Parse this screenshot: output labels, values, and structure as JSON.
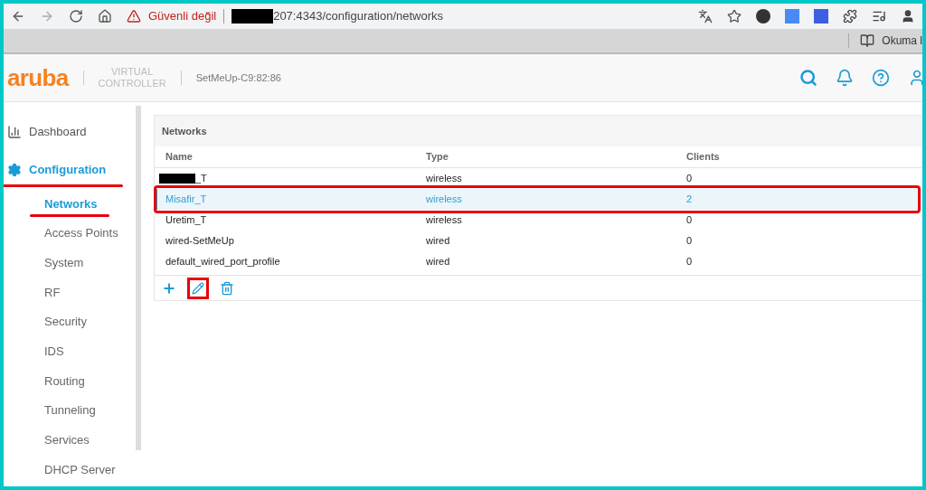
{
  "browser": {
    "security_label": "Güvenli değil",
    "url": "207:4343/configuration/networks",
    "bookmark": "Okuma l"
  },
  "header": {
    "logo": "aruba",
    "product_line1": "VIRTUAL",
    "product_line2": "CONTROLLER",
    "device": "SetMeUp-C9:82:86"
  },
  "sidebar": {
    "items": [
      {
        "label": "Dashboard",
        "kind": "dashboard",
        "selected": false
      },
      {
        "label": "Configuration",
        "kind": "settings",
        "selected": true,
        "children": [
          {
            "label": "Networks",
            "selected": true
          },
          {
            "label": "Access Points",
            "selected": false
          },
          {
            "label": "System",
            "selected": false
          },
          {
            "label": "RF",
            "selected": false
          },
          {
            "label": "Security",
            "selected": false
          },
          {
            "label": "IDS",
            "selected": false
          },
          {
            "label": "Routing",
            "selected": false
          },
          {
            "label": "Tunneling",
            "selected": false
          },
          {
            "label": "Services",
            "selected": false
          },
          {
            "label": "DHCP Server",
            "selected": false
          }
        ]
      }
    ]
  },
  "panel": {
    "title": "Networks",
    "columns": [
      "Name",
      "Type",
      "Clients"
    ],
    "rows": [
      {
        "name": "_T",
        "redacted": true,
        "type": "wireless",
        "clients": "0",
        "selected": false
      },
      {
        "name": "Misafir_T",
        "redacted": false,
        "type": "wireless",
        "clients": "2",
        "selected": true
      },
      {
        "name": "Uretim_T",
        "redacted": false,
        "type": "wireless",
        "clients": "0",
        "selected": false
      },
      {
        "name": "wired-SetMeUp",
        "redacted": false,
        "type": "wired",
        "clients": "0",
        "selected": false
      },
      {
        "name": "default_wired_port_profile",
        "redacted": false,
        "type": "wired",
        "clients": "0",
        "selected": false
      }
    ]
  }
}
